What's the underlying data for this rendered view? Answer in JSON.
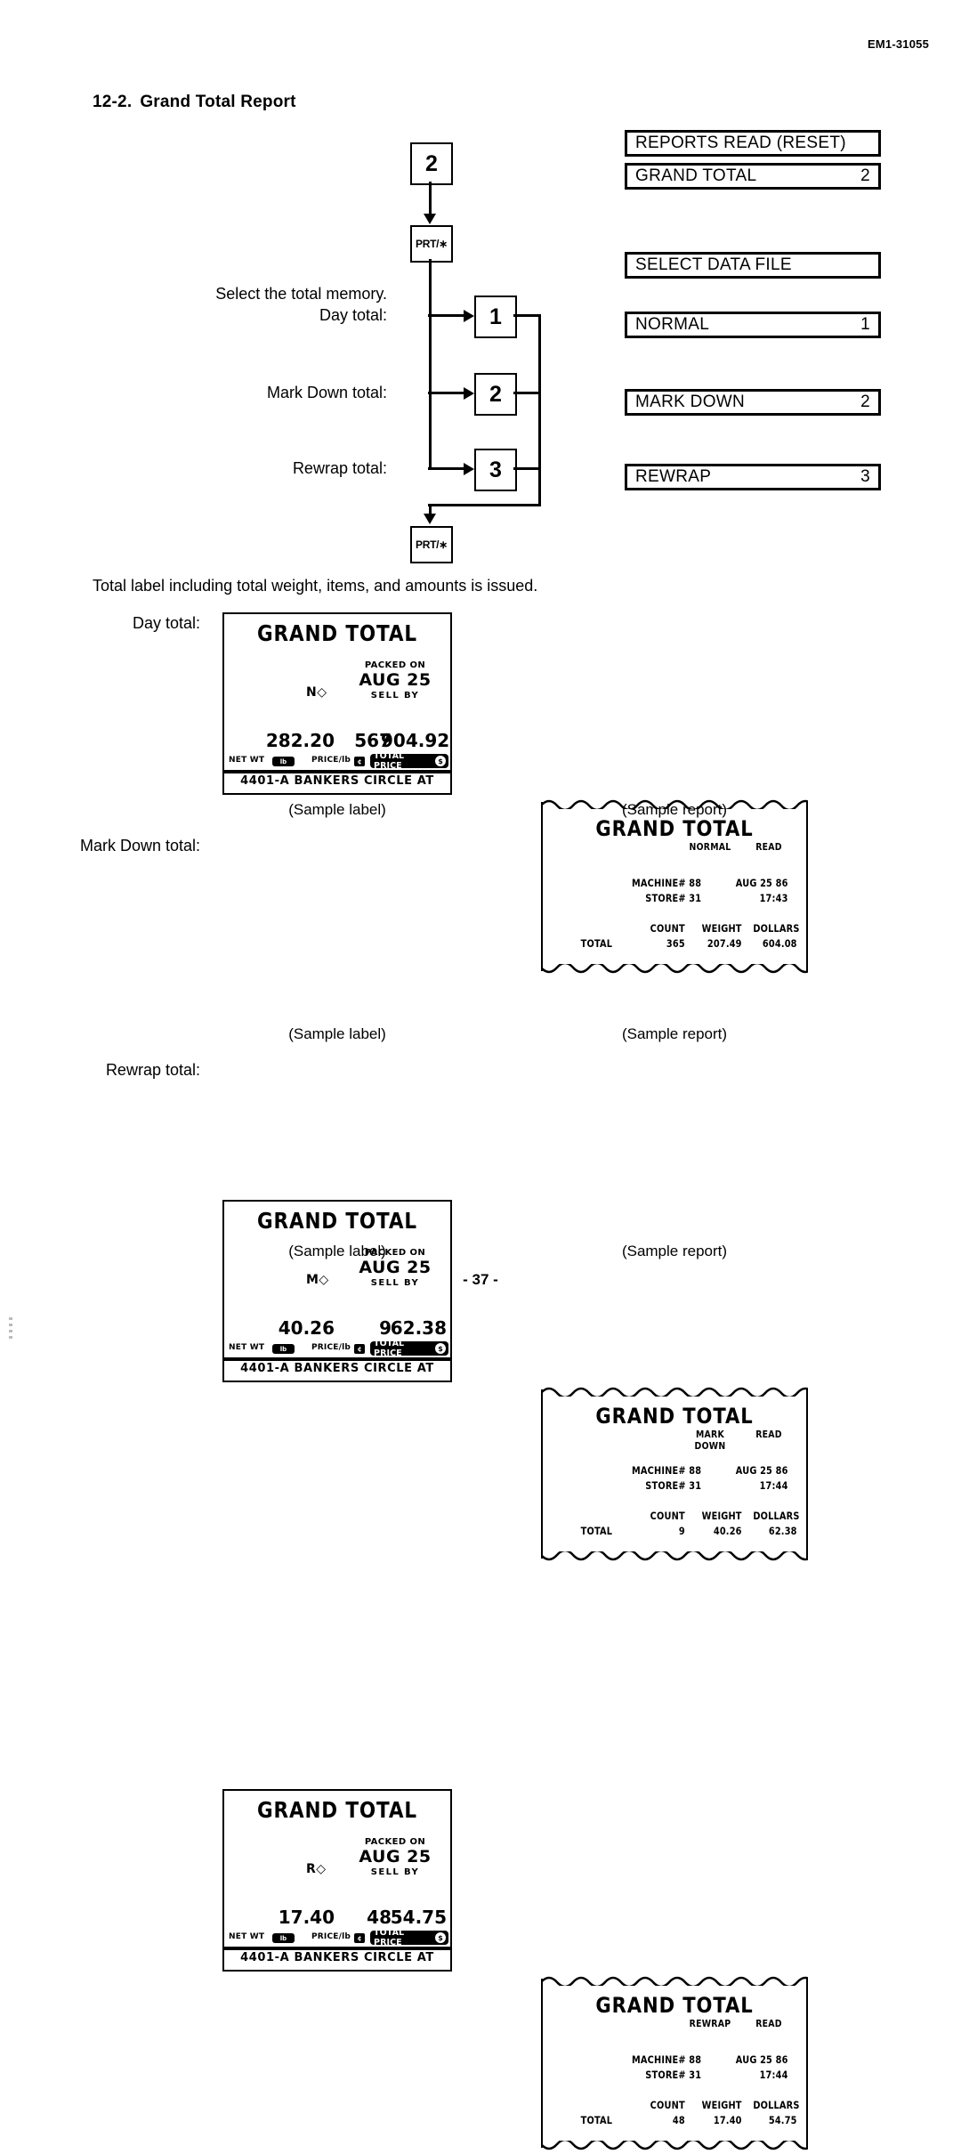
{
  "document": {
    "code": "EM1-31055",
    "page_number": "- 37 -",
    "section_number": "12-2.",
    "section_title": "Grand Total Report",
    "body_sentence": "Total label including total weight, items, and amounts is issued."
  },
  "flow": {
    "keys": {
      "start": "2",
      "print_top": "PRT/∗",
      "print_bottom": "PRT/∗",
      "opt1": "1",
      "opt2": "2",
      "opt3": "3"
    },
    "instruction": "Select the total memory.",
    "labels": {
      "day": "Day total:",
      "markdown": "Mark Down total:",
      "rewrap": "Rewrap total:"
    }
  },
  "displays": [
    {
      "text": "REPORTS READ (RESET)",
      "value": ""
    },
    {
      "text": "GRAND TOTAL",
      "value": "2"
    },
    {
      "text": "SELECT DATA FILE",
      "value": ""
    },
    {
      "text": "NORMAL",
      "value": "1"
    },
    {
      "text": "MARK DOWN",
      "value": "2"
    },
    {
      "text": "REWRAP",
      "value": "3"
    }
  ],
  "captions": {
    "label": "(Sample label)",
    "report": "(Sample report)"
  },
  "label_common": {
    "title": "GRAND TOTAL",
    "packed_on": "PACKED ON",
    "date": "AUG 25",
    "sell_by": "SELL  BY",
    "net_wt": "NET WT",
    "price_lb": "PRICE/lb",
    "total_price": "TOTAL PRICE",
    "icon_lb": "lb",
    "icon_cents": "¢",
    "icon_dollar": "$",
    "address": "4401-A BANKERS CIRCLE AT"
  },
  "report_common": {
    "title": "GRAND TOTAL",
    "read": "READ",
    "machine": "MACHINE# 88",
    "store": "STORE# 31",
    "date": "AUG 25 86",
    "col_count": "COUNT",
    "col_weight": "WEIGHT",
    "col_dollars": "DOLLARS",
    "row_total": "TOTAL"
  },
  "sections": [
    {
      "row_label": "Day total:",
      "label": {
        "mark": "N◇",
        "weight": "282.20",
        "count": "567",
        "amount": "904.92"
      },
      "report": {
        "mode": "NORMAL",
        "time": "17:43",
        "count": "365",
        "weight": "207.49",
        "dollars": "604.08"
      }
    },
    {
      "row_label": "Mark Down total:",
      "label": {
        "mark": "M◇",
        "weight": "40.26",
        "count": "9",
        "amount": "62.38"
      },
      "report": {
        "mode": "MARK DOWN",
        "time": "17:44",
        "count": "9",
        "weight": "40.26",
        "dollars": "62.38"
      }
    },
    {
      "row_label": "Rewrap total:",
      "label": {
        "mark": "R◇",
        "weight": "17.40",
        "count": "48",
        "amount": "54.75"
      },
      "report": {
        "mode": "REWRAP",
        "time": "17:44",
        "count": "48",
        "weight": "17.40",
        "dollars": "54.75"
      }
    }
  ]
}
